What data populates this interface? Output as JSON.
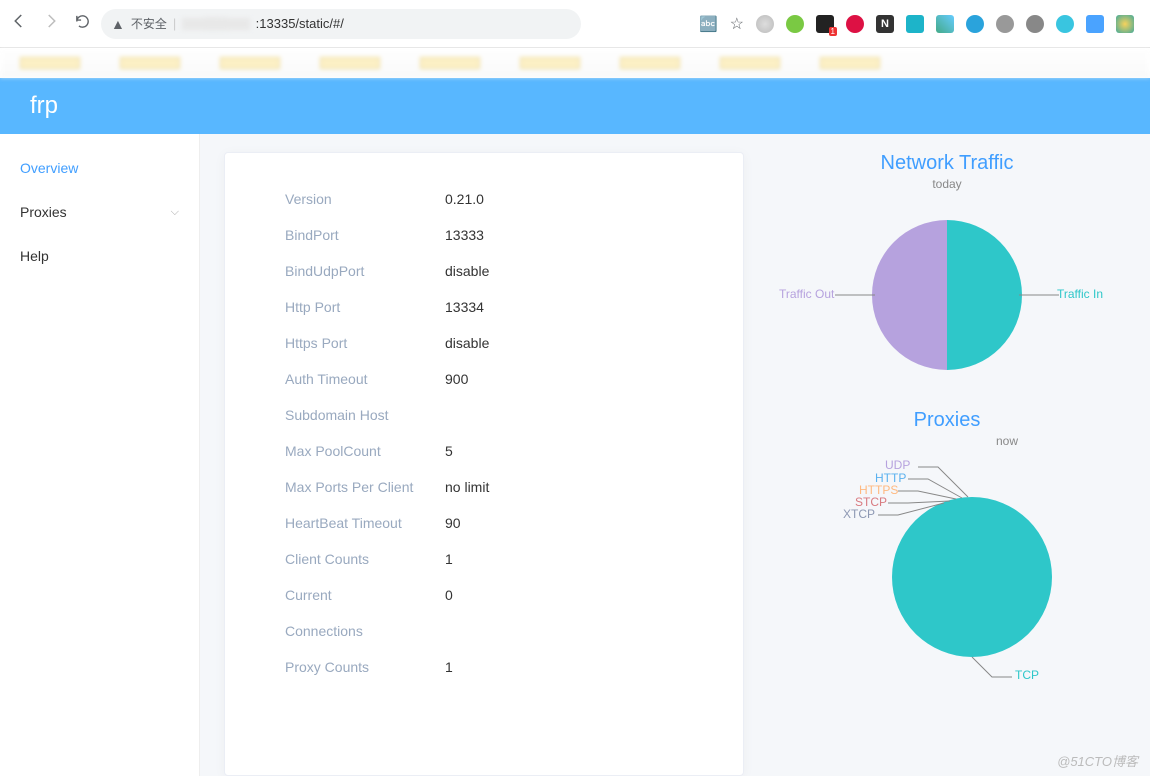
{
  "browser": {
    "unsafe_label": "不安全",
    "url_suffix": ":13335/static/#/"
  },
  "header": {
    "title": "frp"
  },
  "sidebar": {
    "items": [
      {
        "label": "Overview",
        "active": true
      },
      {
        "label": "Proxies",
        "expandable": true
      },
      {
        "label": "Help"
      }
    ]
  },
  "overview": {
    "rows": [
      {
        "label": "Version",
        "value": "0.21.0"
      },
      {
        "label": "BindPort",
        "value": "13333"
      },
      {
        "label": "BindUdpPort",
        "value": "disable"
      },
      {
        "label": "Http Port",
        "value": "13334"
      },
      {
        "label": "Https Port",
        "value": "disable"
      },
      {
        "label": "Auth Timeout",
        "value": "900"
      },
      {
        "label": "Subdomain Host",
        "value": ""
      },
      {
        "label": "Max PoolCount",
        "value": "5"
      },
      {
        "label": "Max Ports Per Client",
        "value": "no limit"
      },
      {
        "label": "HeartBeat Timeout",
        "value": "90"
      },
      {
        "label": "Client Counts",
        "value": "1"
      },
      {
        "label": "Current",
        "value": "0"
      },
      {
        "label": "Connections",
        "value": ""
      },
      {
        "label": "Proxy Counts",
        "value": "1"
      }
    ]
  },
  "chart_data": [
    {
      "type": "pie",
      "title": "Network Traffic",
      "subtitle": "today",
      "series": [
        {
          "name": "Traffic In",
          "value": 50,
          "color": "#2ec7c9"
        },
        {
          "name": "Traffic Out",
          "value": 50,
          "color": "#b6a2de"
        }
      ]
    },
    {
      "type": "pie",
      "title": "Proxies",
      "subtitle": "now",
      "series": [
        {
          "name": "TCP",
          "value": 100,
          "color": "#2ec7c9"
        },
        {
          "name": "UDP",
          "value": 0,
          "color": "#b6a2de"
        },
        {
          "name": "HTTP",
          "value": 0,
          "color": "#5ab1ef"
        },
        {
          "name": "HTTPS",
          "value": 0,
          "color": "#ffb980"
        },
        {
          "name": "STCP",
          "value": 0,
          "color": "#d87a80"
        },
        {
          "name": "XTCP",
          "value": 0,
          "color": "#8d98b3"
        }
      ]
    }
  ],
  "watermark": "@51CTO博客"
}
